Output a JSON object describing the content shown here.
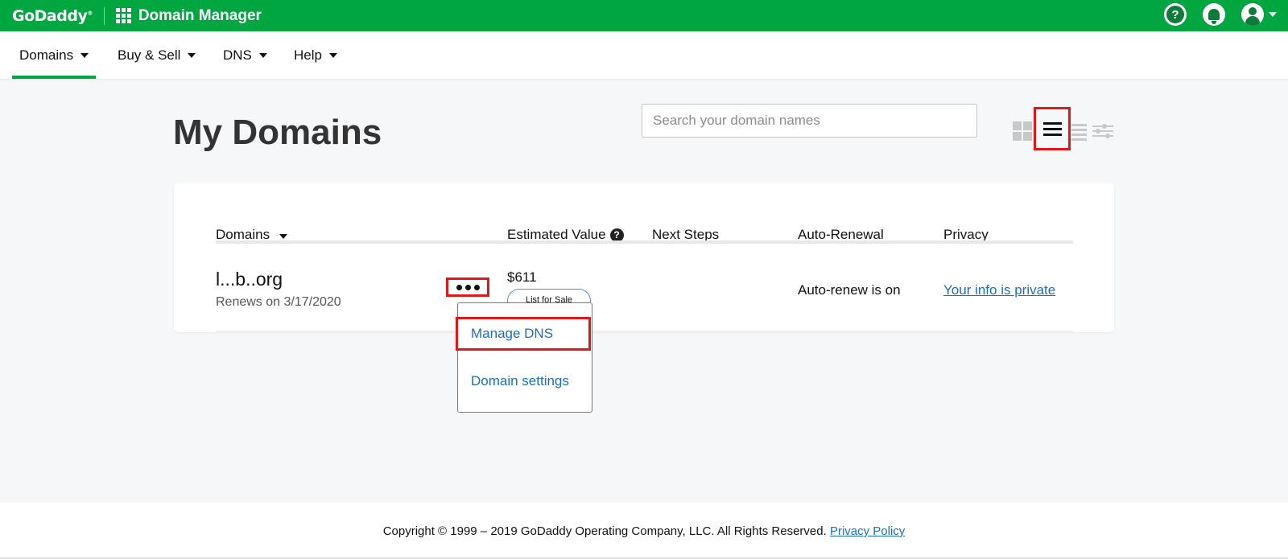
{
  "topbar": {
    "logo": "GoDaddy",
    "app_title": "Domain Manager",
    "help_glyph": "?"
  },
  "nav": {
    "items": [
      {
        "label": "Domains"
      },
      {
        "label": "Buy & Sell"
      },
      {
        "label": "DNS"
      },
      {
        "label": "Help"
      }
    ]
  },
  "page": {
    "title": "My Domains",
    "search_placeholder": "Search your domain names"
  },
  "table": {
    "headers": {
      "domains": "Domains",
      "estimated_value": "Estimated Value",
      "next_steps": "Next Steps",
      "auto_renewal": "Auto-Renewal",
      "privacy": "Privacy"
    },
    "rows": [
      {
        "domain": "l...b..org",
        "renews": "Renews on 3/17/2020",
        "estimated_value": "$611",
        "list_for_sale": "List for Sale",
        "auto_renewal": "Auto-renew is on",
        "privacy": "Your info is private"
      }
    ]
  },
  "dropdown": {
    "manage_dns": "Manage DNS",
    "domain_settings": "Domain settings"
  },
  "footer": {
    "copyright": "Copyright © 1999 – 2019 GoDaddy Operating Company, LLC. All Rights Reserved.",
    "privacy_policy": "Privacy Policy"
  },
  "colors": {
    "brand_green": "#00a63f",
    "link_blue": "#1a6fc2",
    "highlight_red": "#e21818"
  }
}
